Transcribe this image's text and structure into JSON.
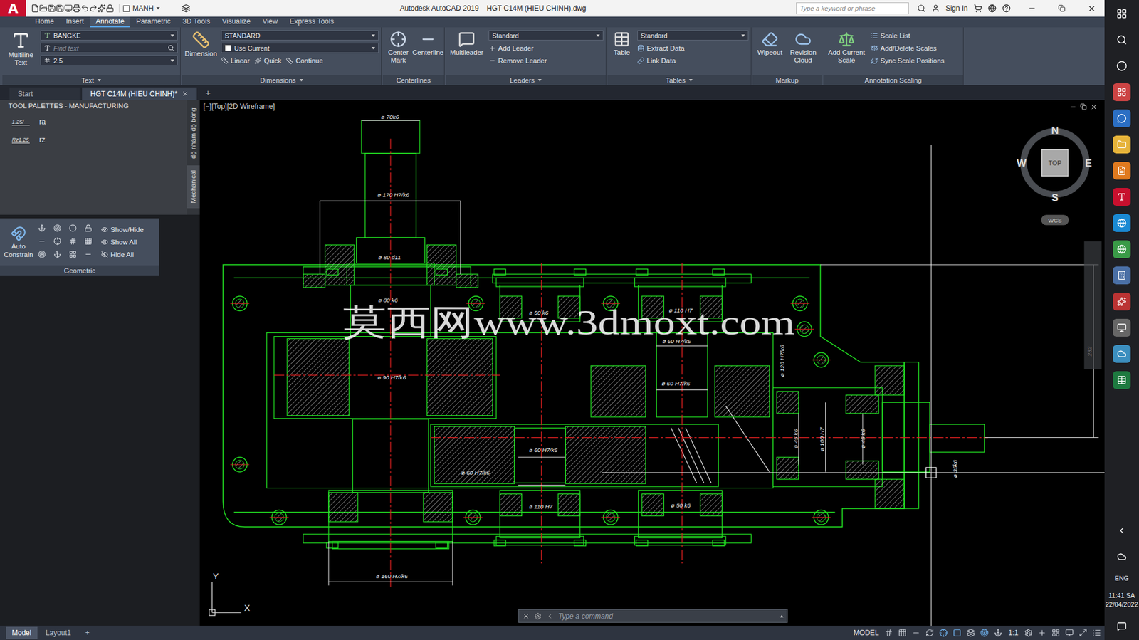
{
  "app": {
    "logo": "A",
    "workspace": "MANH",
    "title": "Autodesk AutoCAD 2019    HGT C14M (HIEU CHINH).dwg",
    "search_placeholder": "Type a keyword or phrase",
    "sign_in": "Sign In"
  },
  "ribbon_tabs": [
    {
      "label": "Home",
      "selected": false
    },
    {
      "label": "Insert",
      "selected": false
    },
    {
      "label": "Annotate",
      "selected": true
    },
    {
      "label": "Parametric",
      "selected": false
    },
    {
      "label": "3D Tools",
      "selected": false
    },
    {
      "label": "Visualize",
      "selected": false
    },
    {
      "label": "View",
      "selected": false
    },
    {
      "label": "Express Tools",
      "selected": false
    }
  ],
  "ribbon_panels": {
    "text": {
      "label": "Text",
      "big": "Multiline Text",
      "style": "BANGKE",
      "find_placeholder": "Find text",
      "height": "2.5"
    },
    "dimensions": {
      "label": "Dimensions",
      "big": "Dimension",
      "style": "STANDARD",
      "layer": "Use Current",
      "buttons": [
        "Linear",
        "Quick",
        "Continue"
      ]
    },
    "centerlines": {
      "label": "Centerlines",
      "buttons": [
        "Center Mark",
        "Centerline"
      ]
    },
    "leaders": {
      "label": "Leaders",
      "big": "Multileader",
      "style": "Standard",
      "buttons": [
        "Add Leader",
        "Remove Leader"
      ]
    },
    "tables": {
      "label": "Tables",
      "big": "Table",
      "style": "Standard",
      "buttons": [
        "Extract Data",
        "Link Data"
      ]
    },
    "markup": {
      "label": "Markup",
      "buttons": [
        "Wipeout",
        "Revision Cloud"
      ]
    },
    "annotation_scaling": {
      "label": "Annotation Scaling",
      "big": "Add Current Scale",
      "buttons": [
        "Scale List",
        "Add/Delete Scales",
        "Sync Scale Positions"
      ]
    }
  },
  "file_tabs": [
    {
      "label": "Start",
      "selected": false
    },
    {
      "label": "HGT C14M (HIEU CHINH)*",
      "selected": true
    }
  ],
  "new_tab": "+",
  "palette": {
    "title": "TOOL PALETTES - MANUFACTURING",
    "items": [
      {
        "symbol": "1.25/",
        "label": "ra"
      },
      {
        "symbol": "Rz1.25",
        "label": "rz"
      }
    ],
    "side_tabs": [
      {
        "label": "độ nhám độ bóng",
        "selected": true
      },
      {
        "label": "Mechanical",
        "selected": false
      }
    ]
  },
  "geometric": {
    "big": "Auto Constrain",
    "buttons": [
      "Show/Hide",
      "Show All",
      "Hide All"
    ],
    "label": "Geometric"
  },
  "viewport": {
    "label": "[−][Top][2D Wireframe]",
    "compass": {
      "n": "N",
      "s": "S",
      "e": "E",
      "w": "W",
      "top": "TOP",
      "wcs": "WCS"
    },
    "watermark": "莫西网www.3dmoxt.com",
    "ucs": {
      "x": "X",
      "y": "Y"
    },
    "dimensions": [
      "ø 70k6",
      "ø 170 H7/k6",
      "ø 80 d11",
      "ø 80 k6",
      "ø 50 k6",
      "ø 110 H7",
      "ø 60 H7/k6",
      "ø 90 H7/k6",
      "ø 60 H7/k6",
      "ø 60 H7/k6",
      "ø 60 H7/k6",
      "ø 110 H7",
      "ø 50 k6",
      "ø 160 H7/k6",
      "ø 120 H7/k6",
      "ø 45 k6",
      "ø 100 H7",
      "ø 45 k6",
      "ø 35k6",
      "232"
    ],
    "command_placeholder": "Type a command"
  },
  "status_bar": {
    "layouts": [
      {
        "label": "Model",
        "selected": true
      },
      {
        "label": "Layout1",
        "selected": false
      }
    ],
    "new_layout": "+",
    "space": "MODEL",
    "scale": "1:1"
  },
  "taskbar": {
    "language": "ENG",
    "time": "11:41 SA",
    "date": "22/04/2022"
  }
}
